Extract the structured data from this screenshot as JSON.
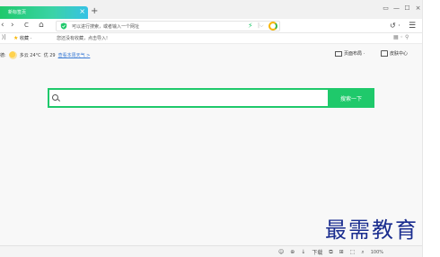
{
  "tab": {
    "title": "新标签页",
    "close": "×",
    "new_tab": "+"
  },
  "window": {
    "restore": "▭",
    "minimize": "—",
    "maximize": "☐",
    "close": "×"
  },
  "toolbar": {
    "back": "‹",
    "forward": "›",
    "refresh": "C",
    "home": "⌂",
    "address_placeholder": "可以进行搜索，或者输入一个网址",
    "bolt": "⚡",
    "chevron": "|⌵",
    "undo": "↺ ·",
    "menu": "☰"
  },
  "bookmarks": {
    "arrow": "⟩|",
    "favorites_label": "收藏 ·",
    "message": "您还没有收藏，点击导入!",
    "right": "▦ ◦ ⚲"
  },
  "weather": {
    "prefix": "德:",
    "condition": "多云 24°C",
    "air": "优 29",
    "link": "查看本周天气 >"
  },
  "page": {
    "layout_label": "页面布局 ·",
    "skin_label": "皮肤中心"
  },
  "search": {
    "placeholder": "",
    "button": "搜索一下"
  },
  "watermark": "最需教育",
  "status": {
    "items": [
      "☺",
      "⊕",
      "↓",
      "下载",
      "⧉",
      "⊞",
      "⬚",
      "⌕"
    ],
    "zoom": "100%"
  },
  "colors": {
    "accent": "#1fc96b",
    "link": "#3a7bd5",
    "watermark": "#1a2d8f"
  }
}
